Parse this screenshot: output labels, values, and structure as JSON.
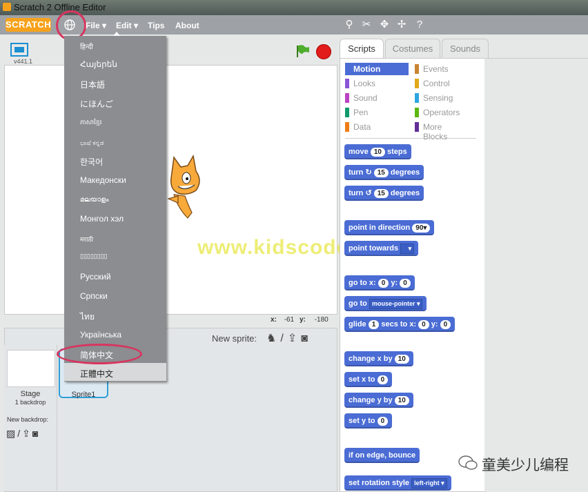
{
  "window": {
    "title": "Scratch 2 Offline Editor"
  },
  "menubar": {
    "logo": "SCRATCH",
    "file": "File ▾",
    "edit": "Edit ▾",
    "tips": "Tips",
    "about": "About"
  },
  "toolbar_icons": [
    "duplicate-icon",
    "cut-icon",
    "grow-icon",
    "shrink-icon",
    "help-icon"
  ],
  "stage": {
    "version": "v441.1",
    "x_label": "x:",
    "x_val": "-61",
    "y_label": "y:",
    "y_val": "-180"
  },
  "sprites": {
    "new_sprite": "New sprite:",
    "stage_label": "Stage",
    "stage_backdrops": "1 backdrop",
    "new_backdrop": "New backdrop:",
    "sprite1": "Sprite1"
  },
  "tabs": {
    "scripts": "Scripts",
    "costumes": "Costumes",
    "sounds": "Sounds"
  },
  "categories": [
    {
      "label": "Motion",
      "color": "#4a6cd4"
    },
    {
      "label": "Looks",
      "color": "#8a55d7"
    },
    {
      "label": "Sound",
      "color": "#bb42c3"
    },
    {
      "label": "Pen",
      "color": "#0e9a6c"
    },
    {
      "label": "Data",
      "color": "#ee7d16"
    },
    {
      "label": "Events",
      "color": "#c88330"
    },
    {
      "label": "Control",
      "color": "#e1a91a"
    },
    {
      "label": "Sensing",
      "color": "#2ca5e2"
    },
    {
      "label": "Operators",
      "color": "#5cb712"
    },
    {
      "label": "More Blocks",
      "color": "#632d99"
    }
  ],
  "blocks": {
    "move": "move",
    "move_v": "10",
    "steps": "steps",
    "turn": "turn",
    "turn_r_v": "15",
    "turn_l_v": "15",
    "degrees": "degrees",
    "point_dir": "point in direction",
    "point_dir_v": "90▾",
    "point_towards": "point towards",
    "goto_xy": "go to x:",
    "goto_x": "0",
    "y": "y:",
    "goto_y": "0",
    "goto": "go to",
    "goto_target": "mouse-pointer ▾",
    "glide": "glide",
    "glide_secs": "1",
    "secs_to_x": "secs to x:",
    "glide_x": "0",
    "glide_y": "0",
    "change_x": "change x by",
    "change_x_v": "10",
    "set_x": "set x to",
    "set_x_v": "0",
    "change_y": "change y by",
    "change_y_v": "10",
    "set_y": "set y to",
    "set_y_v": "0",
    "bounce": "if on edge, bounce",
    "rotation": "set rotation style",
    "rotation_v": "left-right ▾"
  },
  "languages": [
    "हिन्दी",
    "Հայերեն",
    "日本語",
    "にほんご",
    "ភាសាខ្មែរ",
    "ಭಾಷೆ ಕನ್ನಡ",
    "한국어",
    "Македонски",
    "മലയാളം",
    "Монгол хэл",
    "मराठी",
    "▯▯▯▯▯▯▯▯",
    "Русский",
    "Српски",
    "ไทย",
    "Українська",
    "简体中文",
    "正體中文"
  ],
  "watermark": "www.kidscoder.cn",
  "footer_watermark": "童美少儿编程"
}
